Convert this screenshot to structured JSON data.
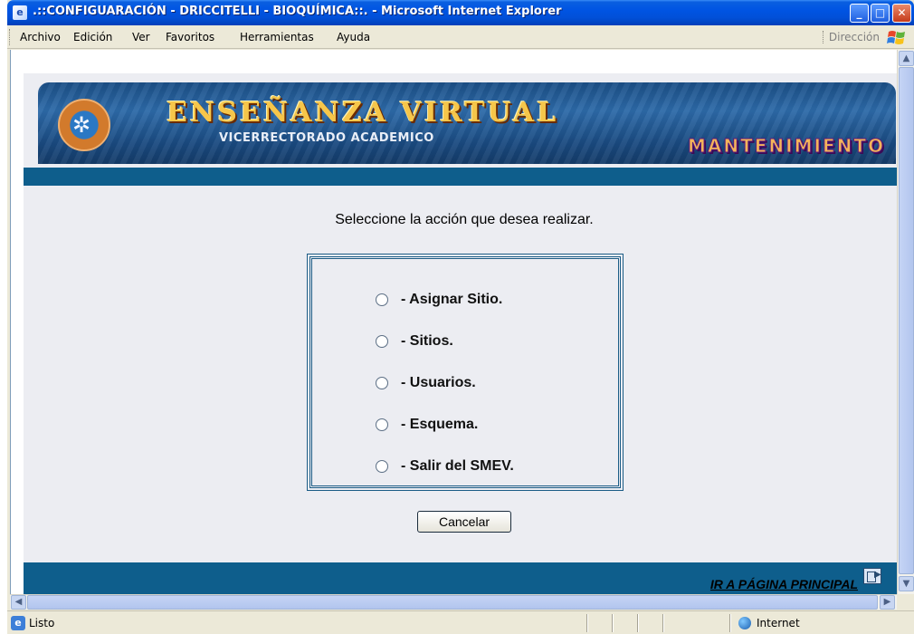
{
  "window": {
    "title": ".::CONFIGUARACIÓN - DRICCITELLI - BIOQUÍMICA::. - Microsoft Internet Explorer",
    "minimize_label": "_",
    "maximize_label": "□",
    "close_label": "✕"
  },
  "menubar": {
    "items": [
      "Archivo",
      "Edición",
      "Ver",
      "Favoritos",
      "Herramientas",
      "Ayuda"
    ],
    "address_label": "Dirección"
  },
  "banner": {
    "title": "ENSEÑANZA VIRTUAL",
    "subtitle": "VICERRECTORADO ACADEMICO",
    "section": "MANTENIMIENTO"
  },
  "main": {
    "instruction": "Seleccione la acción que desea realizar.",
    "options": [
      "- Asignar Sitio.",
      "- Sitios.",
      "- Usuarios.",
      "- Esquema.",
      "- Salir del SMEV."
    ],
    "cancel_label": "Cancelar",
    "home_link": "IR A PÁGINA PRINCIPAL"
  },
  "statusbar": {
    "status": "Listo",
    "zone": "Internet"
  },
  "colors": {
    "band": "#0e5e8c",
    "titlebar": "#0054e3",
    "banner_title": "#f6c64a",
    "section_badge": "#f4b45a"
  }
}
